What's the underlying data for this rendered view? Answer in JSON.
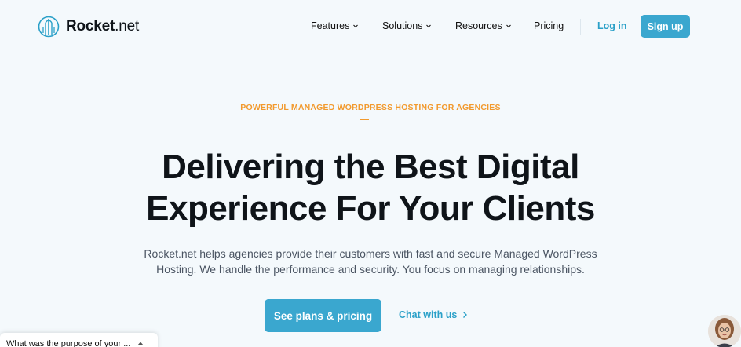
{
  "brand": {
    "name_bold": "Rocket",
    "name_light": ".net"
  },
  "nav": {
    "items": [
      {
        "label": "Features",
        "has_dropdown": true
      },
      {
        "label": "Solutions",
        "has_dropdown": true
      },
      {
        "label": "Resources",
        "has_dropdown": true
      },
      {
        "label": "Pricing",
        "has_dropdown": false
      }
    ],
    "login_label": "Log in",
    "signup_label": "Sign up"
  },
  "hero": {
    "eyebrow": "POWERFUL MANAGED WORDPRESS HOSTING FOR AGENCIES",
    "headline_line1": "Delivering the Best Digital",
    "headline_line2": "Experience For Your Clients",
    "subtext_line1": "Rocket.net helps agencies provide their customers with fast and secure Managed WordPress",
    "subtext_line2": "Hosting. We handle the performance and security. You focus on managing relationships.",
    "cta_label": "See plans & pricing",
    "chat_label": "Chat with us"
  },
  "survey": {
    "question": "What was the purpose of your ..."
  },
  "colors": {
    "accent": "#3aa7cf",
    "link": "#2aa0c8",
    "eyebrow": "#f29a2e",
    "background": "#f4f9fc",
    "heading": "#0f1419"
  },
  "icons": {
    "logo": "rocket-building-logo-icon",
    "dropdown": "chevron-down-icon",
    "chat_arrow": "chevron-right-icon",
    "survey_toggle": "caret-up-icon"
  }
}
